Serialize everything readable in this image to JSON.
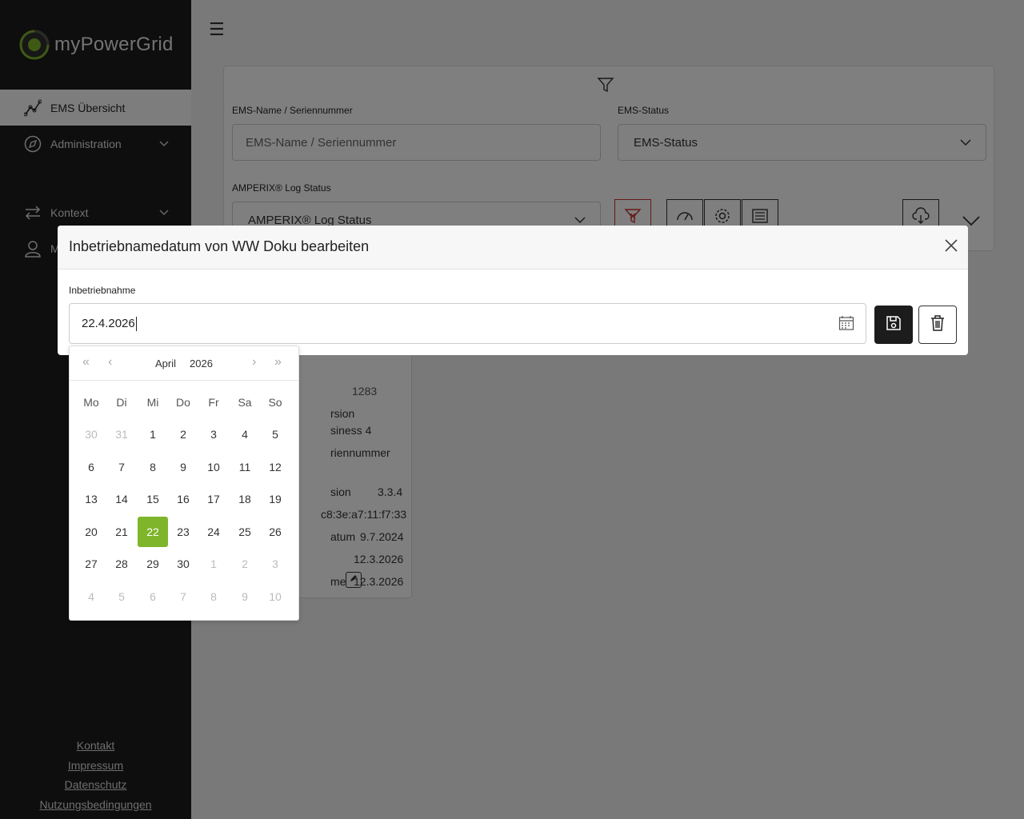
{
  "app": {
    "logo_text": "myPowerGrid"
  },
  "sidebar": {
    "items": [
      {
        "label": "EMS Übersicht",
        "icon": "chart-line-icon"
      },
      {
        "label": "Administration",
        "icon": "compass-icon"
      },
      {
        "label": "Kontext",
        "icon": "arrows-swap-icon"
      },
      {
        "label": "M",
        "icon": "user-icon"
      }
    ],
    "footer": [
      "Kontakt",
      "Impressum",
      "Datenschutz",
      "Nutzungsbedingungen"
    ]
  },
  "filters": {
    "ems_name_label": "EMS-Name / Seriennummer",
    "ems_name_placeholder": "EMS-Name / Seriennummer",
    "ems_status_label": "EMS-Status",
    "ems_status_value": "EMS-Status",
    "log_status_label": "AMPERIX® Log Status",
    "log_status_value": "AMPERIX® Log Status"
  },
  "detail_card": {
    "lines": [
      "1283",
      "rsion",
      "siness 4",
      "riennummer",
      "sion",
      "3.3.4",
      "c8:3e:a7:11:f7:33",
      "atum",
      "9.7.2024",
      "12.3.2026",
      "me",
      "12.3.2026"
    ]
  },
  "modal": {
    "title": "Inbetriebnamedatum von WW Doku bearbeiten",
    "field_label": "Inbetriebnahme",
    "date_value": "22.4.2026"
  },
  "calendar": {
    "month": "April",
    "year": "2026",
    "weekdays": [
      "Mo",
      "Di",
      "Mi",
      "Do",
      "Fr",
      "Sa",
      "So"
    ],
    "weeks": [
      [
        "30",
        "31",
        "1",
        "2",
        "3",
        "4",
        "5"
      ],
      [
        "6",
        "7",
        "8",
        "9",
        "10",
        "11",
        "12"
      ],
      [
        "13",
        "14",
        "15",
        "16",
        "17",
        "18",
        "19"
      ],
      [
        "20",
        "21",
        "22",
        "23",
        "24",
        "25",
        "26"
      ],
      [
        "27",
        "28",
        "29",
        "30",
        "1",
        "2",
        "3"
      ],
      [
        "4",
        "5",
        "6",
        "7",
        "8",
        "9",
        "10"
      ]
    ],
    "selected": "22",
    "accent": "#7fb52a"
  }
}
